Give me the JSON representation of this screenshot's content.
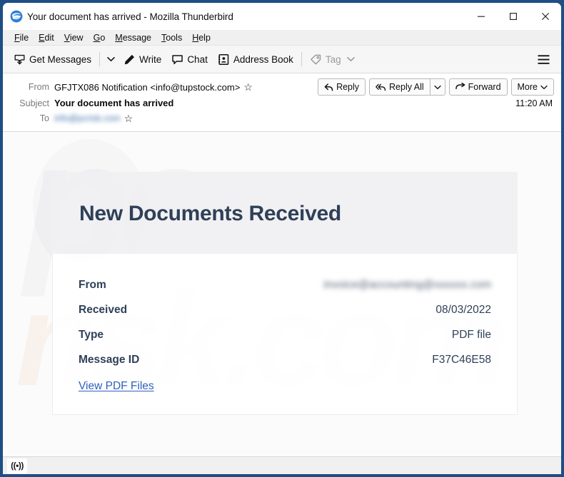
{
  "window": {
    "title": "Your document has arrived - Mozilla Thunderbird",
    "logo_icon": "thunderbird-logo",
    "controls": {
      "minimize": "minimize-icon",
      "maximize": "maximize-icon",
      "close": "close-icon"
    }
  },
  "menubar": {
    "items": [
      {
        "label": "File",
        "accesskey": "F"
      },
      {
        "label": "Edit",
        "accesskey": "E"
      },
      {
        "label": "View",
        "accesskey": "V"
      },
      {
        "label": "Go",
        "accesskey": "G"
      },
      {
        "label": "Message",
        "accesskey": "M"
      },
      {
        "label": "Tools",
        "accesskey": "T"
      },
      {
        "label": "Help",
        "accesskey": "H"
      }
    ]
  },
  "toolbar": {
    "get_messages": "Get Messages",
    "get_messages_icon": "download-mail-icon",
    "get_messages_caret_icon": "chevron-down-icon",
    "write": "Write",
    "write_icon": "pencil-icon",
    "chat": "Chat",
    "chat_icon": "speech-bubble-icon",
    "address_book": "Address Book",
    "address_book_icon": "address-book-icon",
    "tag": "Tag",
    "tag_icon": "tag-icon",
    "tag_caret_icon": "chevron-down-icon",
    "tag_disabled": true,
    "app_menu_icon": "hamburger-menu-icon"
  },
  "message_header": {
    "from_label": "From",
    "from_value": "GFJTX086 Notification <info@tupstock.com>",
    "subject_label": "Subject",
    "subject_value": "Your document has arrived",
    "to_label": "To",
    "to_value": "info@pcrisk.com",
    "to_value_blurred": true,
    "time": "11:20 AM",
    "star_icon": "star-outline-icon",
    "actions": {
      "reply": "Reply",
      "reply_icon": "reply-arrow-icon",
      "reply_all": "Reply All",
      "reply_all_icon": "reply-all-arrow-icon",
      "reply_all_caret_icon": "chevron-down-icon",
      "forward": "Forward",
      "forward_icon": "forward-arrow-icon",
      "more": "More",
      "more_caret_icon": "chevron-down-icon"
    }
  },
  "email": {
    "heading": "New Documents Received",
    "rows": [
      {
        "label": "From",
        "value": "invoice@accounting@xxxxxx.com",
        "blurred": true
      },
      {
        "label": "Received",
        "value": "08/03/2022",
        "blurred": false
      },
      {
        "label": "Type",
        "value": "PDF file",
        "blurred": false
      },
      {
        "label": "Message ID",
        "value": "F37C46E58",
        "blurred": false
      }
    ],
    "link": "View PDF Files",
    "watermark_primary": "pc",
    "watermark_secondary": "risk.com"
  },
  "statusbar": {
    "connection_icon": "((•))",
    "connection_icon_name": "network-activity-icon"
  },
  "colors": {
    "window_border": "#1f4e87",
    "heading": "#2f4058",
    "link": "#2d5fbd",
    "toolbar_bg": "#f6f6f6",
    "card_head_bg": "#f0f0f2"
  }
}
